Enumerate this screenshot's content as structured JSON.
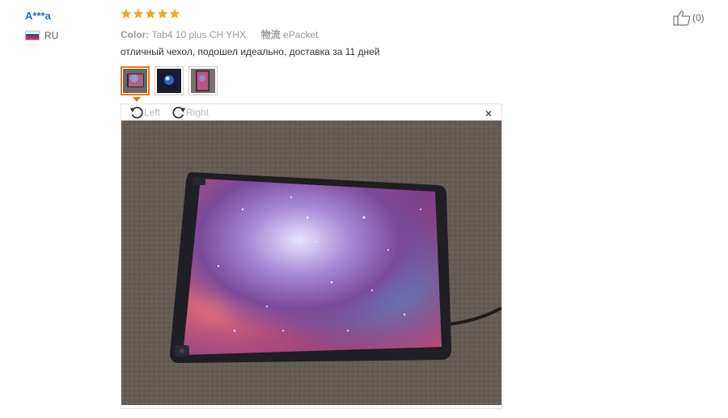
{
  "review": {
    "user_name": "A***a",
    "country": "RU",
    "rating": 5,
    "color_label": "Color:",
    "color_value": "Tab4 10 plus CH YHX",
    "shipping_label": "物流",
    "shipping_value": "ePacket",
    "text": "отличный чехол, подошел идеально, доставка за 11 дней"
  },
  "viewer": {
    "rotate_left_label": "Left",
    "rotate_right_label": "Right",
    "close_symbol": "×",
    "photo_icon": "tablet-galaxy-case-photo"
  },
  "like": {
    "count": "(0)",
    "icon": "thumbs-up-icon"
  },
  "colors": {
    "star": "#f5a623",
    "user_link": "#2a6db8",
    "thumb_selected_border": "#e9770e"
  }
}
